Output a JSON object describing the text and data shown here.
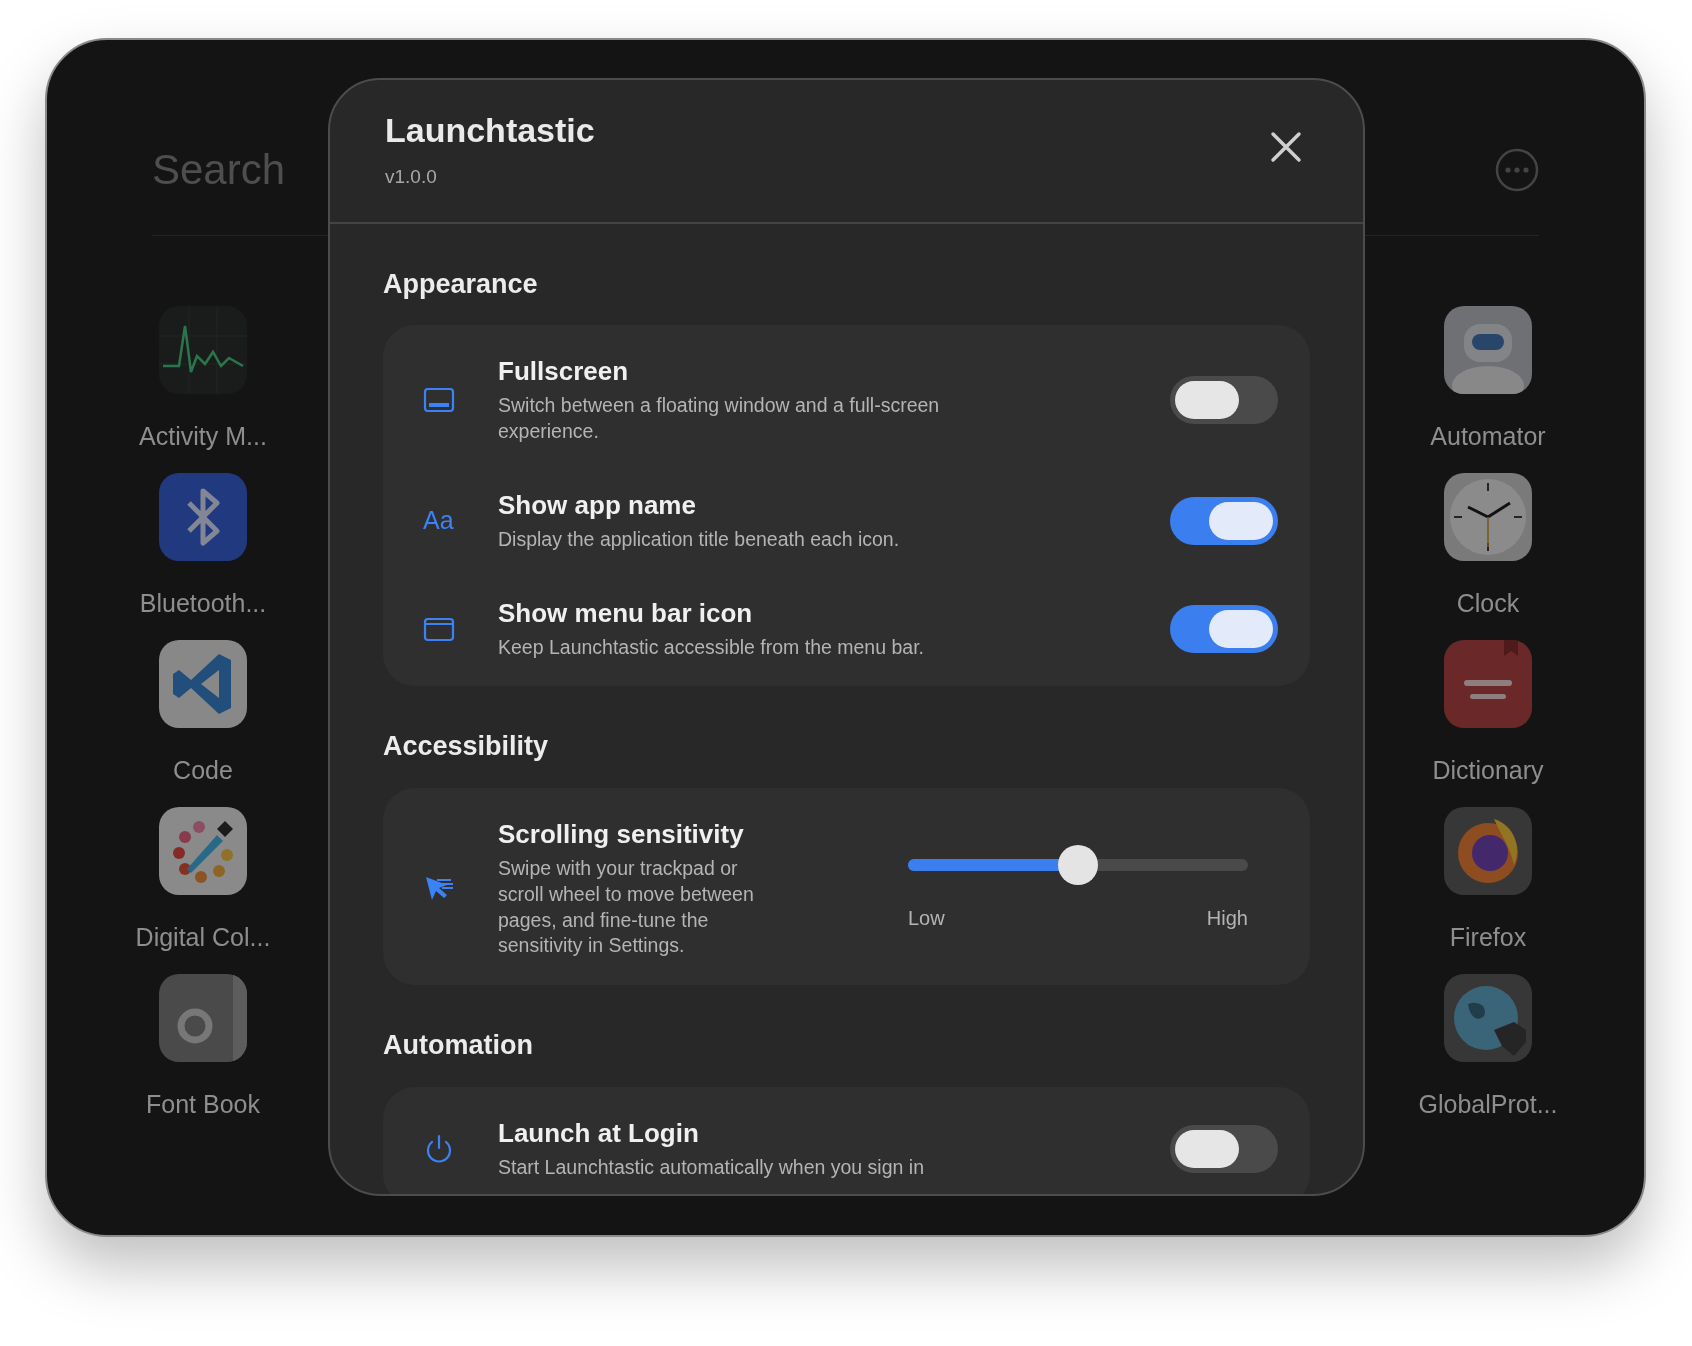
{
  "launcher": {
    "search": {
      "placeholder": "Search"
    },
    "apps_left": [
      {
        "label": "Activity M..."
      },
      {
        "label": "Bluetooth..."
      },
      {
        "label": "Code"
      },
      {
        "label": "Digital Col..."
      },
      {
        "label": "Font Book"
      }
    ],
    "apps_right": [
      {
        "label": "Automator"
      },
      {
        "label": "Clock"
      },
      {
        "label": "Dictionary"
      },
      {
        "label": "Firefox"
      },
      {
        "label": "GlobalProt..."
      }
    ]
  },
  "dialog": {
    "title": "Launchtastic",
    "version": "v1.0.0",
    "sections": [
      {
        "heading": "Appearance",
        "items": [
          {
            "kind": "toggle",
            "title": "Fullscreen",
            "description": "Switch between a floating window and a full-screen experience.",
            "on": false
          },
          {
            "kind": "toggle",
            "icon_glyph": "Aa",
            "title": "Show app name",
            "description": "Display the application title beneath each icon.",
            "on": true
          },
          {
            "kind": "toggle",
            "title": "Show menu bar icon",
            "description": "Keep Launchtastic accessible from the menu bar.",
            "on": true
          }
        ]
      },
      {
        "heading": "Accessibility",
        "items": [
          {
            "kind": "slider",
            "title": "Scrolling sensitivity",
            "description": "Swipe with your trackpad or scroll wheel to move between pages, and fine-tune the sensitivity in Settings.",
            "level": 0.5,
            "min_label": "Low",
            "max_label": "High"
          }
        ]
      },
      {
        "heading": "Automation",
        "items": [
          {
            "kind": "toggle",
            "title": "Launch at Login",
            "description": "Start Launchtastic automatically when you sign in",
            "on": false
          }
        ]
      }
    ]
  }
}
